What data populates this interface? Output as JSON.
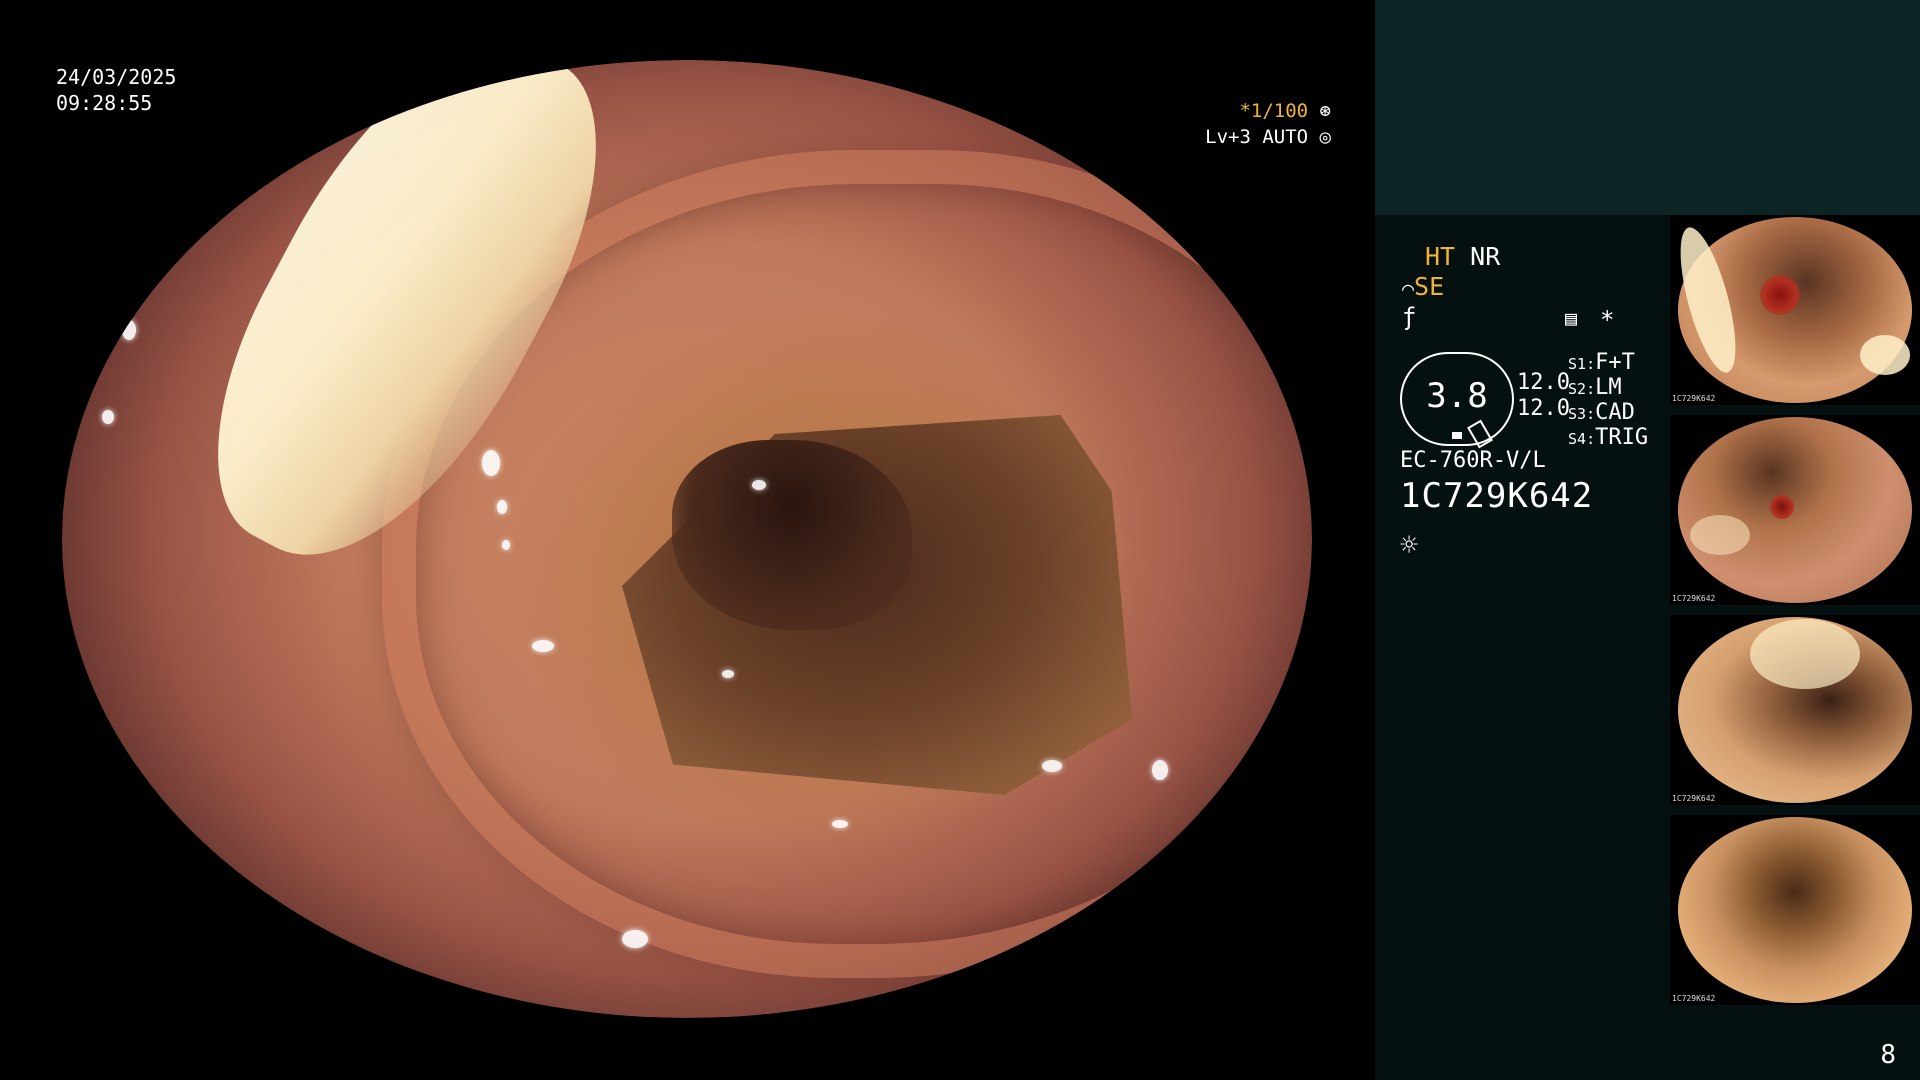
{
  "osd": {
    "date": "24/03/2025",
    "time": "09:28:55",
    "shutter": "*1/100",
    "shutter_icon": "iris-icon",
    "exposure": "Lv+3 AUTO",
    "exposure_icon": "auto-icon"
  },
  "panel": {
    "mode_ht": "HT",
    "mode_nr": "NR",
    "mode_se": "SE",
    "asterisk": "*",
    "sharpness": "3.8",
    "gain_1": "12.0",
    "gain_2": "12.0",
    "switches": [
      {
        "key": "S1",
        "value": "F+T"
      },
      {
        "key": "S2",
        "value": "LM"
      },
      {
        "key": "S3",
        "value": "CAD"
      },
      {
        "key": "S4",
        "value": "TRIG"
      }
    ],
    "scope_model": "EC-760R-V/L",
    "serial": "1C729K642"
  },
  "page_number": "8",
  "colors": {
    "accent_amber": "#f2b233",
    "panel_dark": "#041110",
    "panel_top": "#0d2425"
  }
}
